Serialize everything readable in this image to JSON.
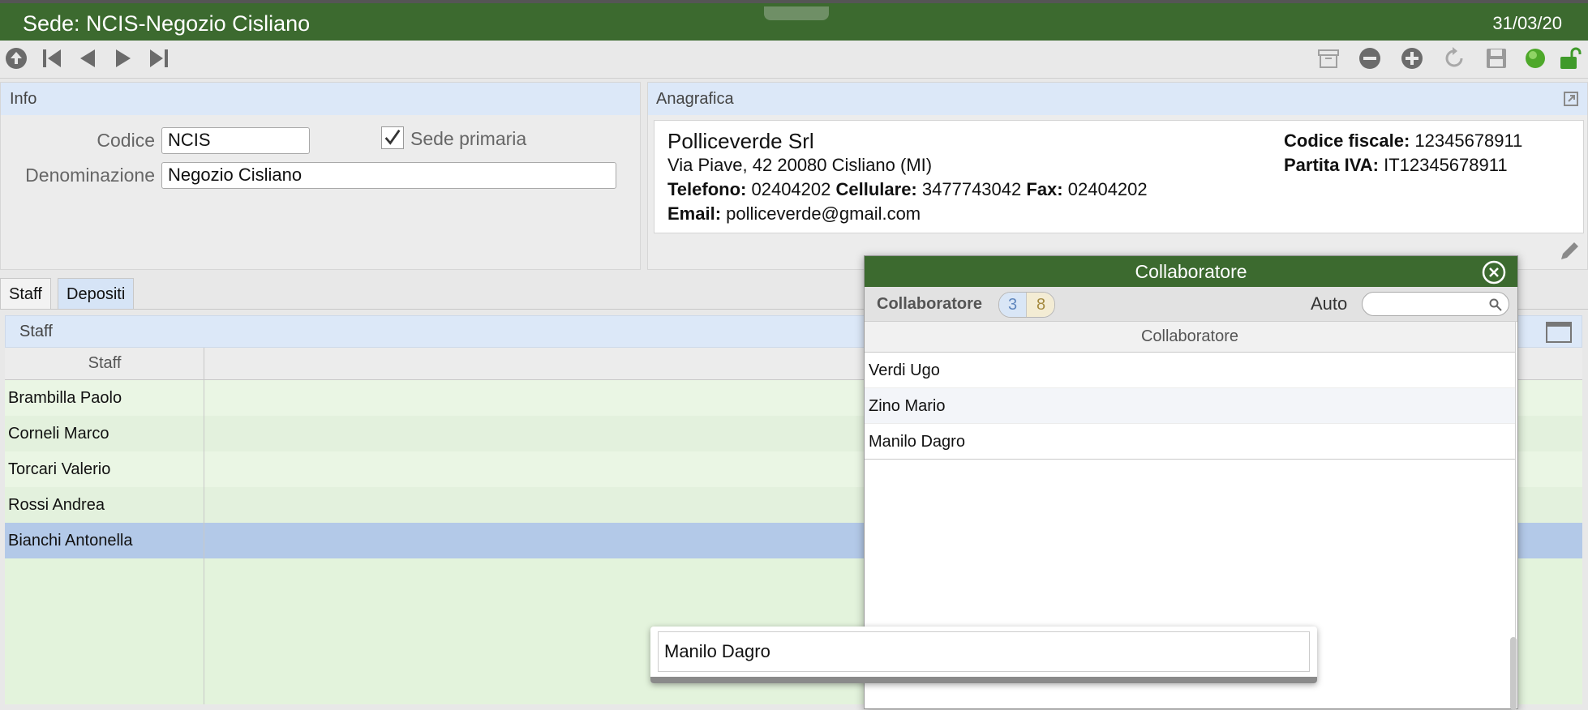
{
  "window": {
    "title": "Sede: NCIS-Negozio Cisliano",
    "date": "31/03/20"
  },
  "toolbar": {
    "left_icons": [
      "up-circle-icon",
      "first-record-icon",
      "prev-record-icon",
      "next-record-icon",
      "last-record-icon"
    ],
    "right_icons": [
      "archive-icon",
      "remove-icon",
      "add-icon",
      "refresh-icon",
      "save-icon",
      "status-green-icon",
      "unlock-icon"
    ]
  },
  "info": {
    "header": "Info",
    "codice_label": "Codice",
    "codice_value": "NCIS",
    "sede_primaria_label": "Sede primaria",
    "sede_primaria_checked": true,
    "denominazione_label": "Denominazione",
    "denominazione_value": "Negozio Cisliano"
  },
  "anagrafica": {
    "header": "Anagrafica",
    "company": "Polliceverde Srl",
    "address": "Via Piave, 42 20080 Cisliano (MI)",
    "telefono_label": "Telefono:",
    "telefono": "02404202",
    "cellulare_label": "Cellulare:",
    "cellulare": "3477743042",
    "fax_label": "Fax:",
    "fax": "02404202",
    "email_label": "Email:",
    "email": "polliceverde@gmail.com",
    "cf_label": "Codice fiscale:",
    "cf": "12345678911",
    "piva_label": "Partita IVA:",
    "piva": "IT12345678911"
  },
  "tabs": [
    {
      "label": "Staff",
      "active": true
    },
    {
      "label": "Depositi",
      "active": false
    }
  ],
  "staff": {
    "header": "Staff",
    "column": "Staff",
    "rows": [
      "Brambilla Paolo",
      "Corneli Marco",
      "Torcari Valerio",
      "Rossi Andrea",
      "Bianchi Antonella"
    ],
    "selected_index": 4
  },
  "popup": {
    "title": "Collaboratore",
    "label": "Collaboratore",
    "count_a": "3",
    "count_b": "8",
    "auto_label": "Auto",
    "search_placeholder": "",
    "column": "Collaboratore",
    "rows": [
      "Verdi Ugo",
      "Zino Mario",
      "Manilo Dagro"
    ]
  },
  "floating": {
    "value": "Manilo Dagro"
  },
  "colors": {
    "title_green": "#3c6a2f",
    "header_blue": "#dce8f8",
    "grid_green": "#e3f3dc",
    "selected_blue": "#b3c9e8"
  }
}
